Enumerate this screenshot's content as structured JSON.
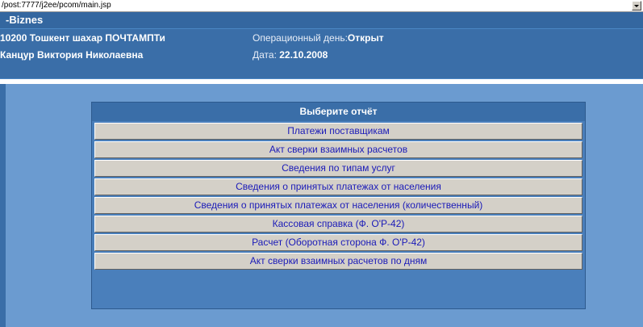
{
  "address_bar": {
    "url": "/post:7777/j2ee/pcom/main.jsp"
  },
  "header": {
    "brand": "-Biznes",
    "office": "10200 Тошкент шахар ПОЧТАМПТи",
    "user": "Канцур Виктория Николаевна",
    "operational_day_label": "Операционный день:",
    "operational_day_value": "Открыт",
    "date_label": "Дата:",
    "date_value": "22.10.2008"
  },
  "reports": {
    "title": "Выберите отчёт",
    "items": [
      "Платежи поставщикам",
      "Акт сверки взаимных расчетов",
      "Сведения по типам услуг",
      "Сведения о принятых платежах от населения",
      "Сведения о принятых платежах от населения (количественный)",
      "Кассовая справка (Ф. О'Р-42)",
      "Расчет (Оборотная сторона Ф. О'Р-42)",
      "Акт сверки взаимных расчетов по дням"
    ]
  },
  "colors": {
    "header_dark": "#3467a0",
    "header_bg": "#3a6ea8",
    "content_bg": "#6b9bd0",
    "button_bg": "#d4d0c8",
    "link_text": "#1a1ab8"
  }
}
